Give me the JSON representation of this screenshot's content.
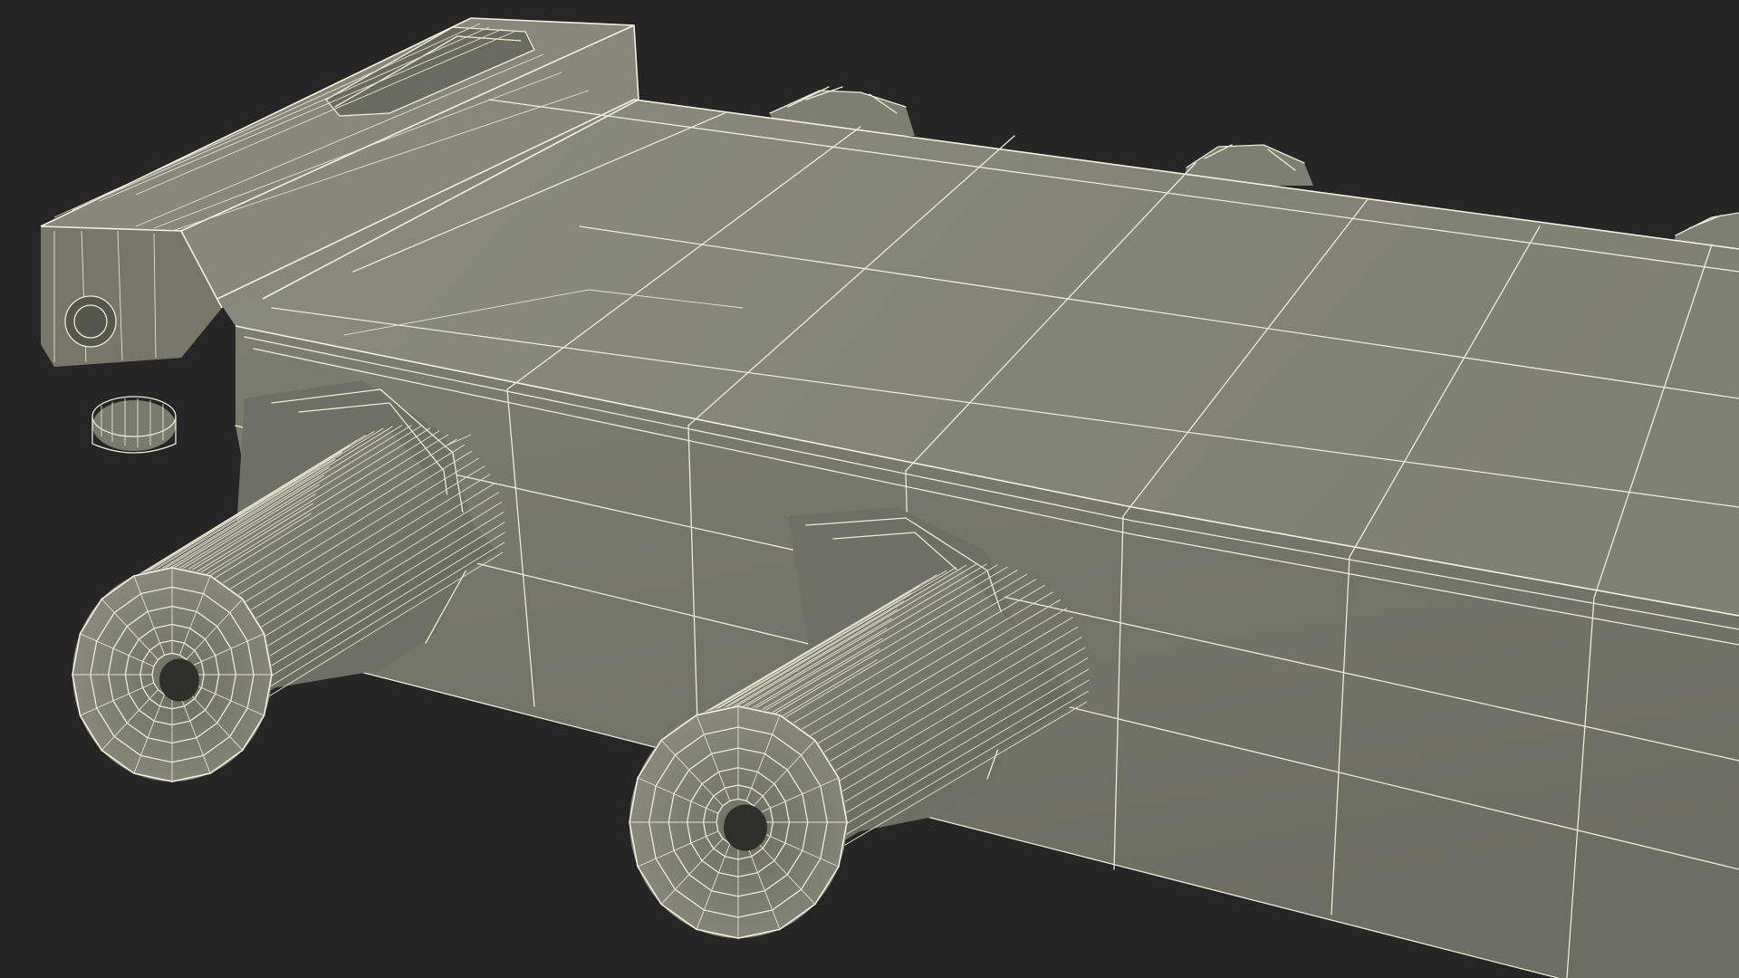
{
  "scene": {
    "subject": "wireframe-3d-model",
    "colors": {
      "background": "#262626",
      "surface_light": "#86877a",
      "surface_mid": "#7b7c70",
      "surface_dark": "#5f6056",
      "wire": "#ecead8"
    },
    "connectors": {
      "visible_count": 2,
      "knurl_ridges": 34,
      "rings": [
        1.0,
        0.82,
        0.64,
        0.47,
        0.32,
        0.2
      ]
    }
  }
}
